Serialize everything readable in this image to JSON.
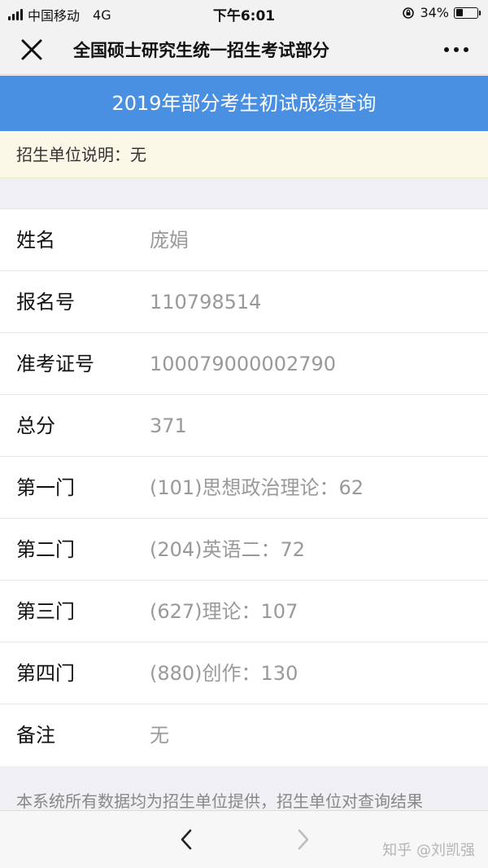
{
  "status_bar": {
    "carrier": "中国移动",
    "network": "4G",
    "time": "下午6:01",
    "battery_text": "34%",
    "battery_level": 0.34
  },
  "nav": {
    "title": "全国硕士研究生统一招生考试部分"
  },
  "header": {
    "title": "2019年部分考生初试成绩查询"
  },
  "notice": {
    "text": "招生单位说明：无"
  },
  "info_rows": [
    {
      "label": "姓名",
      "value": "庞娟"
    },
    {
      "label": "报名号",
      "value": "110798514"
    },
    {
      "label": "准考证号",
      "value": "100079000002790"
    },
    {
      "label": "总分",
      "value": "371"
    },
    {
      "label": "第一门",
      "value": "(101)思想政治理论：62"
    },
    {
      "label": "第二门",
      "value": "(204)英语二：72"
    },
    {
      "label": "第三门",
      "value": "(627)理论：107"
    },
    {
      "label": "第四门",
      "value": "(880)创作：130"
    },
    {
      "label": "备注",
      "value": "无"
    }
  ],
  "footnote": {
    "text": "本系统所有数据均为招生单位提供，招生单位对查询结果"
  },
  "bottom_bar": {
    "watermark": "知乎 @刘凯强"
  },
  "icons": {
    "close": "close-icon",
    "more": "more-dots-icon",
    "back": "chevron-left-icon",
    "forward": "chevron-right-icon",
    "signal": "signal-bars-icon",
    "battery": "battery-icon",
    "rotation_lock": "rotation-lock-icon"
  },
  "colors": {
    "header_bg": "#4a90e2",
    "notice_bg": "#fbf8e7",
    "value_text": "#999999"
  }
}
